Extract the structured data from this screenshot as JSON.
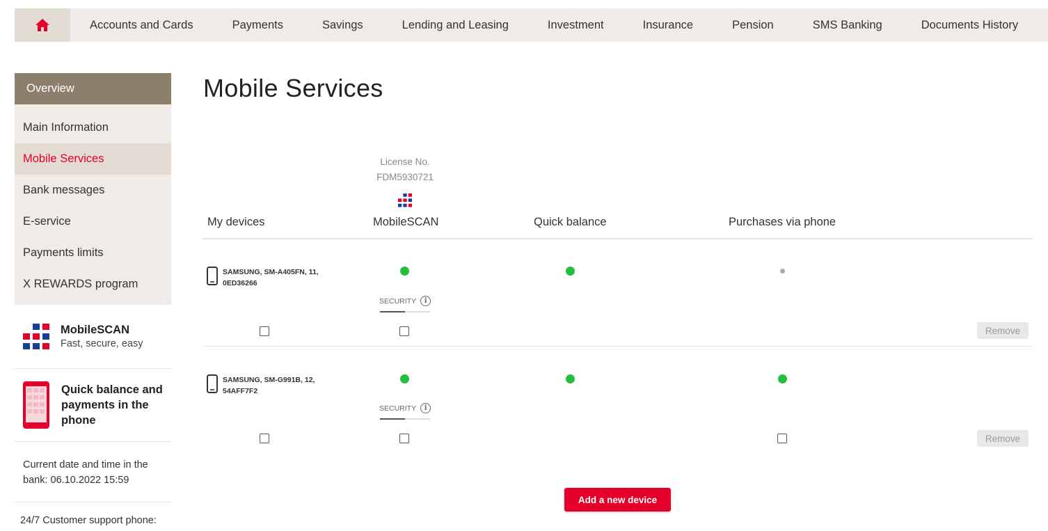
{
  "colors": {
    "accent": "#e4002b",
    "overview_bg": "#8c7f6c",
    "nav_bg": "#efebe6",
    "active_dot": "#22c03c",
    "inactive_dot": "#aaaaaa"
  },
  "topnav": {
    "home_icon": "home-icon",
    "items": [
      "Accounts and Cards",
      "Payments",
      "Savings",
      "Lending and Leasing",
      "Investment",
      "Insurance",
      "Pension",
      "SMS Banking",
      "Documents History"
    ]
  },
  "sidebar": {
    "overview": "Overview",
    "items": [
      "Main Information",
      "Mobile Services",
      "Bank messages",
      "E-service",
      "Payments limits",
      "X REWARDS program"
    ],
    "active_item": "Mobile Services",
    "promo_mobilescan": {
      "title": "MobileSCAN",
      "subtitle": "Fast, secure, easy"
    },
    "promo_quick": {
      "line1": "Quick balance and",
      "line2": "payments in the",
      "line3": "phone"
    },
    "datetime": {
      "line1": "Current date and time in the",
      "line2": "bank: 06.10.2022 15:59"
    },
    "support": "24/7 Customer support phone:"
  },
  "main": {
    "title": "Mobile Services",
    "license_label": "License No.",
    "license_number": "FDM5930721",
    "columns": [
      "My devices",
      "MobileSCAN",
      "Quick balance",
      "Purchases via phone"
    ],
    "security_label": "SECURITY",
    "devices": [
      {
        "name_line1": "SAMSUNG, SM-A405FN, 11,",
        "name_line2": "0ED36266",
        "mobilescan": "active",
        "quick_balance": "active",
        "purchases": "inactive",
        "remove_label": "Remove"
      },
      {
        "name_line1": "SAMSUNG, SM-G991B, 12,",
        "name_line2": "54AFF7F2",
        "mobilescan": "active",
        "quick_balance": "active",
        "purchases": "active",
        "remove_label": "Remove"
      }
    ],
    "add_device_label": "Add a new device"
  }
}
